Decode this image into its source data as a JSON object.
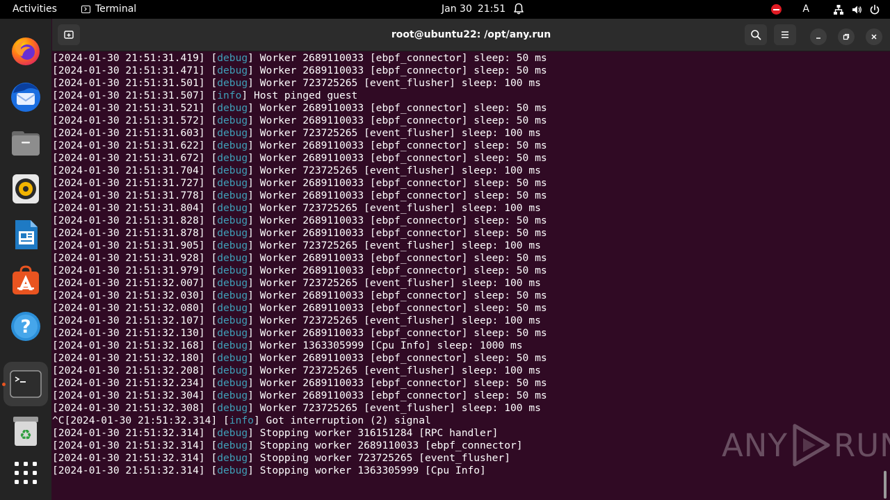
{
  "topbar": {
    "activities": "Activities",
    "app_name": "Terminal",
    "date": "Jan 30",
    "time": "21:51",
    "input_source": "A"
  },
  "dock": {
    "items": [
      {
        "name": "Firefox"
      },
      {
        "name": "Thunderbird Mail"
      },
      {
        "name": "Files"
      },
      {
        "name": "Rhythmbox"
      },
      {
        "name": "LibreOffice Writer"
      },
      {
        "name": "Ubuntu Software"
      },
      {
        "name": "Help"
      },
      {
        "name": "Terminal",
        "active": true
      },
      {
        "name": "Trash"
      },
      {
        "name": "Show Applications"
      }
    ]
  },
  "window": {
    "title": "root@ubuntu22: /opt/any.run"
  },
  "terminal": {
    "lines": [
      {
        "pre": "[2024-01-30 21:51:31.419] [",
        "level": "debug",
        "post": "] Worker 2689110033 [ebpf_connector] sleep: 50 ms"
      },
      {
        "pre": "[2024-01-30 21:51:31.471] [",
        "level": "debug",
        "post": "] Worker 2689110033 [ebpf_connector] sleep: 50 ms"
      },
      {
        "pre": "[2024-01-30 21:51:31.501] [",
        "level": "debug",
        "post": "] Worker 723725265 [event_flusher] sleep: 100 ms"
      },
      {
        "pre": "[2024-01-30 21:51:31.507] [",
        "level": "info",
        "post": "] Host pinged guest"
      },
      {
        "pre": "[2024-01-30 21:51:31.521] [",
        "level": "debug",
        "post": "] Worker 2689110033 [ebpf_connector] sleep: 50 ms"
      },
      {
        "pre": "[2024-01-30 21:51:31.572] [",
        "level": "debug",
        "post": "] Worker 2689110033 [ebpf_connector] sleep: 50 ms"
      },
      {
        "pre": "[2024-01-30 21:51:31.603] [",
        "level": "debug",
        "post": "] Worker 723725265 [event_flusher] sleep: 100 ms"
      },
      {
        "pre": "[2024-01-30 21:51:31.622] [",
        "level": "debug",
        "post": "] Worker 2689110033 [ebpf_connector] sleep: 50 ms"
      },
      {
        "pre": "[2024-01-30 21:51:31.672] [",
        "level": "debug",
        "post": "] Worker 2689110033 [ebpf_connector] sleep: 50 ms"
      },
      {
        "pre": "[2024-01-30 21:51:31.704] [",
        "level": "debug",
        "post": "] Worker 723725265 [event_flusher] sleep: 100 ms"
      },
      {
        "pre": "[2024-01-30 21:51:31.727] [",
        "level": "debug",
        "post": "] Worker 2689110033 [ebpf_connector] sleep: 50 ms"
      },
      {
        "pre": "[2024-01-30 21:51:31.778] [",
        "level": "debug",
        "post": "] Worker 2689110033 [ebpf_connector] sleep: 50 ms"
      },
      {
        "pre": "[2024-01-30 21:51:31.804] [",
        "level": "debug",
        "post": "] Worker 723725265 [event_flusher] sleep: 100 ms"
      },
      {
        "pre": "[2024-01-30 21:51:31.828] [",
        "level": "debug",
        "post": "] Worker 2689110033 [ebpf_connector] sleep: 50 ms"
      },
      {
        "pre": "[2024-01-30 21:51:31.878] [",
        "level": "debug",
        "post": "] Worker 2689110033 [ebpf_connector] sleep: 50 ms"
      },
      {
        "pre": "[2024-01-30 21:51:31.905] [",
        "level": "debug",
        "post": "] Worker 723725265 [event_flusher] sleep: 100 ms"
      },
      {
        "pre": "[2024-01-30 21:51:31.928] [",
        "level": "debug",
        "post": "] Worker 2689110033 [ebpf_connector] sleep: 50 ms"
      },
      {
        "pre": "[2024-01-30 21:51:31.979] [",
        "level": "debug",
        "post": "] Worker 2689110033 [ebpf_connector] sleep: 50 ms"
      },
      {
        "pre": "[2024-01-30 21:51:32.007] [",
        "level": "debug",
        "post": "] Worker 723725265 [event_flusher] sleep: 100 ms"
      },
      {
        "pre": "[2024-01-30 21:51:32.030] [",
        "level": "debug",
        "post": "] Worker 2689110033 [ebpf_connector] sleep: 50 ms"
      },
      {
        "pre": "[2024-01-30 21:51:32.080] [",
        "level": "debug",
        "post": "] Worker 2689110033 [ebpf_connector] sleep: 50 ms"
      },
      {
        "pre": "[2024-01-30 21:51:32.107] [",
        "level": "debug",
        "post": "] Worker 723725265 [event_flusher] sleep: 100 ms"
      },
      {
        "pre": "[2024-01-30 21:51:32.130] [",
        "level": "debug",
        "post": "] Worker 2689110033 [ebpf_connector] sleep: 50 ms"
      },
      {
        "pre": "[2024-01-30 21:51:32.168] [",
        "level": "debug",
        "post": "] Worker 1363305999 [Cpu Info] sleep: 1000 ms"
      },
      {
        "pre": "[2024-01-30 21:51:32.180] [",
        "level": "debug",
        "post": "] Worker 2689110033 [ebpf_connector] sleep: 50 ms"
      },
      {
        "pre": "[2024-01-30 21:51:32.208] [",
        "level": "debug",
        "post": "] Worker 723725265 [event_flusher] sleep: 100 ms"
      },
      {
        "pre": "[2024-01-30 21:51:32.234] [",
        "level": "debug",
        "post": "] Worker 2689110033 [ebpf_connector] sleep: 50 ms"
      },
      {
        "pre": "[2024-01-30 21:51:32.304] [",
        "level": "debug",
        "post": "] Worker 2689110033 [ebpf_connector] sleep: 50 ms"
      },
      {
        "pre": "[2024-01-30 21:51:32.308] [",
        "level": "debug",
        "post": "] Worker 723725265 [event_flusher] sleep: 100 ms"
      },
      {
        "pre": "^C[2024-01-30 21:51:32.314] [",
        "level": "info",
        "post": "] Got interruption (2) signal"
      },
      {
        "pre": "[2024-01-30 21:51:32.314] [",
        "level": "debug",
        "post": "] Stopping worker 316151284 [RPC handler]"
      },
      {
        "pre": "[2024-01-30 21:51:32.314] [",
        "level": "debug",
        "post": "] Stopping worker 2689110033 [ebpf_connector]"
      },
      {
        "pre": "[2024-01-30 21:51:32.314] [",
        "level": "debug",
        "post": "] Stopping worker 723725265 [event_flusher]"
      },
      {
        "pre": "[2024-01-30 21:51:32.314] [",
        "level": "debug",
        "post": "] Stopping worker 1363305999 [Cpu Info]"
      }
    ]
  },
  "watermark": {
    "left": "ANY",
    "right": "RUN"
  },
  "colors": {
    "terminal_bg": "#300a24",
    "log_level": "#3f9fb8",
    "accent": "#e95420"
  }
}
